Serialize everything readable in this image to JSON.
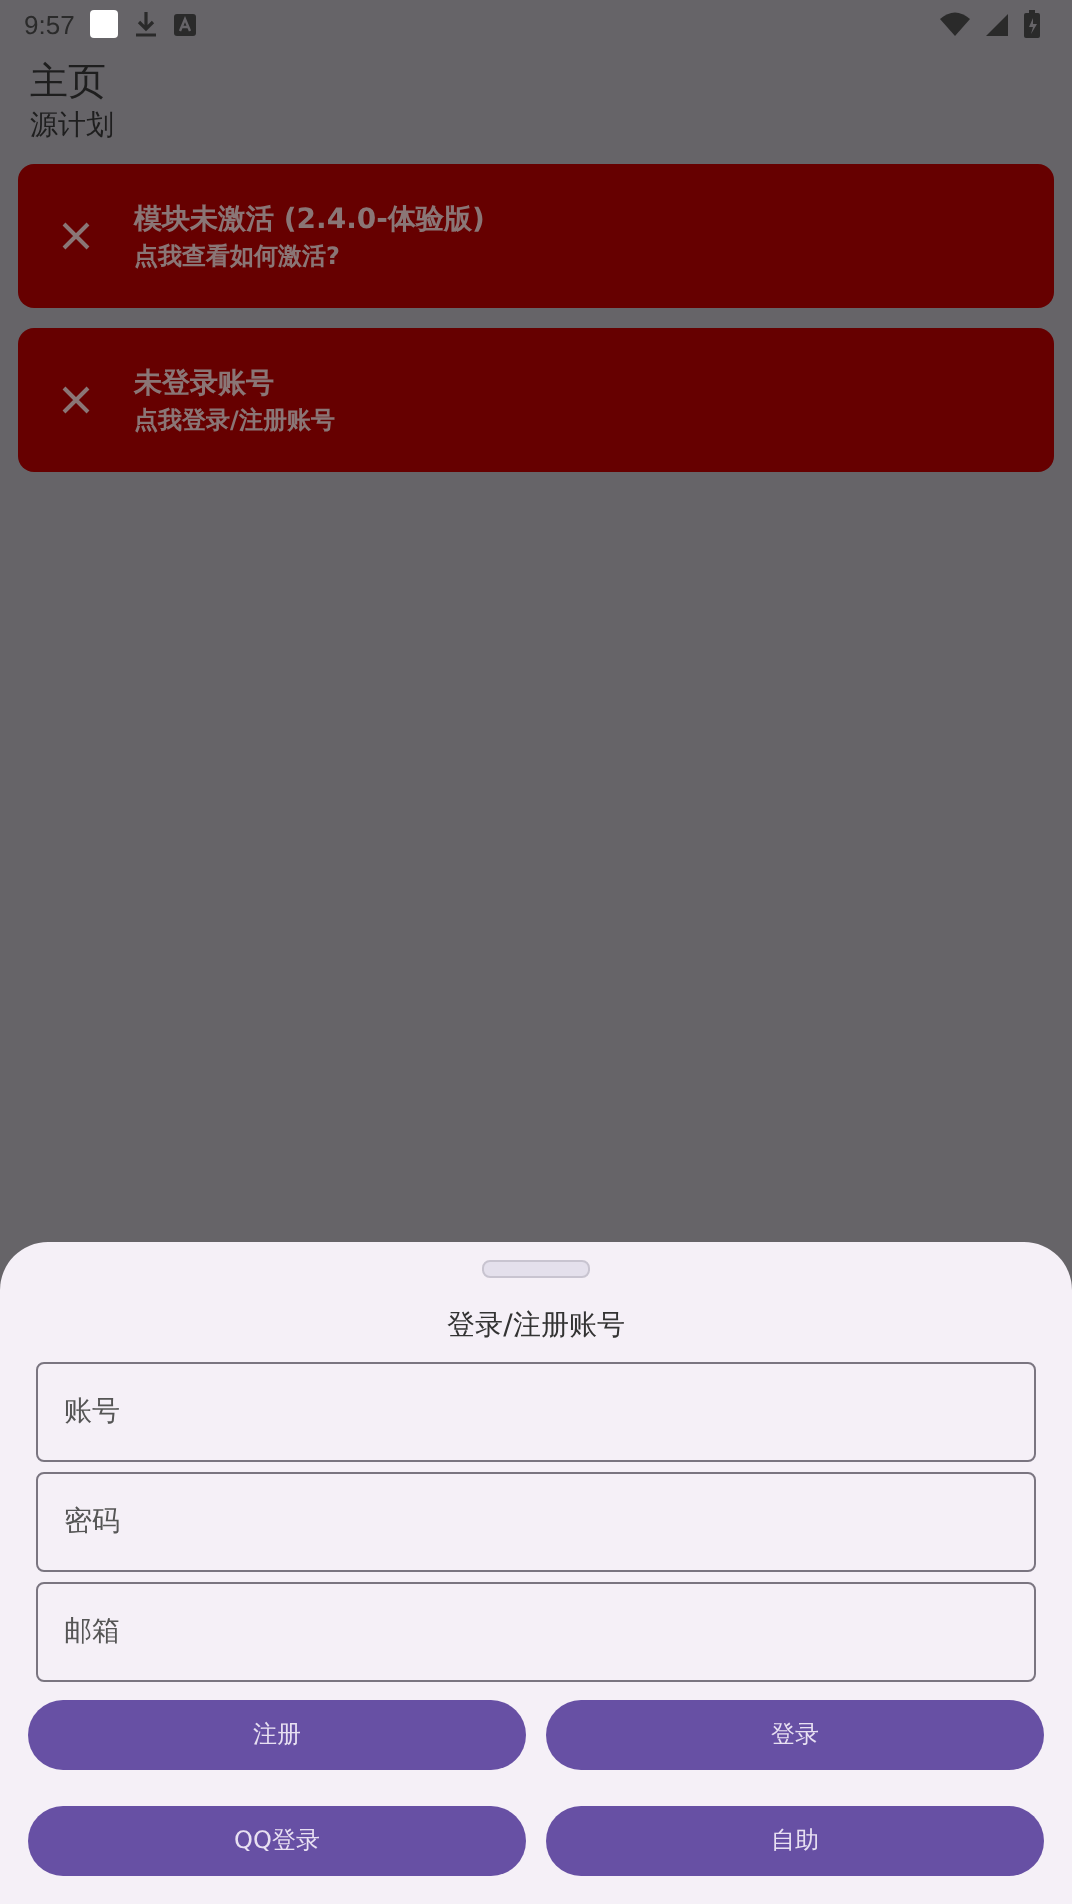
{
  "status_bar": {
    "time": "9:57"
  },
  "header": {
    "title": "主页",
    "subtitle": "源计划"
  },
  "cards": [
    {
      "title": "模块未激活 (2.4.0-体验版)",
      "subtitle": "点我查看如何激活?"
    },
    {
      "title": "未登录账号",
      "subtitle": "点我登录/注册账号"
    }
  ],
  "sheet": {
    "title": "登录/注册账号",
    "fields": [
      {
        "placeholder": "账号"
      },
      {
        "placeholder": "密码"
      },
      {
        "placeholder": "邮箱"
      }
    ],
    "buttons": [
      {
        "label": "注册"
      },
      {
        "label": "登录"
      },
      {
        "label": "QQ登录"
      },
      {
        "label": "自助"
      }
    ]
  }
}
